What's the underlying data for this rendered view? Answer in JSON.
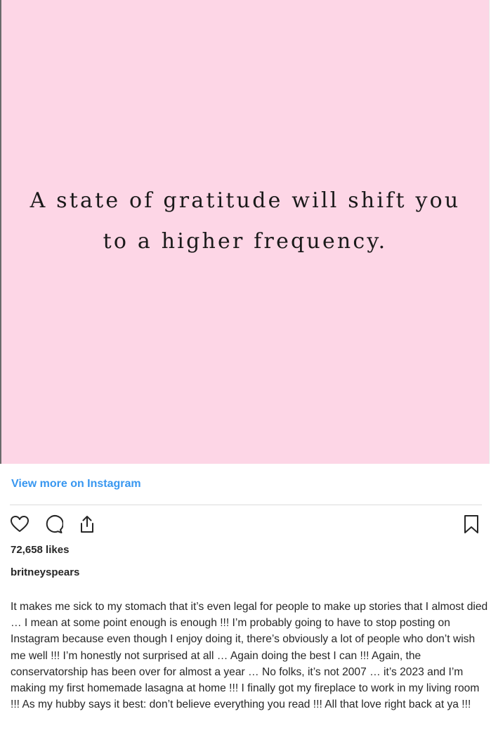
{
  "post": {
    "image": {
      "background_color": "#fdd6e6",
      "quote_line_1": "A state of gratitude will shift you",
      "quote_line_2": "to a higher frequency."
    },
    "view_more_link": "View more on Instagram",
    "actions": {
      "like_icon": "heart-icon",
      "comment_icon": "comment-icon",
      "share_icon": "share-icon",
      "save_icon": "bookmark-icon"
    },
    "likes": "72,658 likes",
    "username": "britneyspears",
    "caption": "It makes me sick to my stomach that it’s even legal for people to make up stories that I almost died … I mean at some point enough is enough !!! I’m probably going to have to stop posting on Instagram because even though I enjoy doing it, there’s obviously a lot of people who don’t wish me well !!! I’m honestly not surprised at all … Again doing the best I can !!! Again, the conservatorship has been over for almost a year … No folks, it’s not 2007 … it’s 2023 and I’m making my first homemade lasagna at home !!! I finally got my fireplace to work in my living room !!! As my hubby says it best: don’t believe everything you read !!! All that love right back at ya !!!"
  },
  "colors": {
    "link": "#3897f0",
    "text": "#262626",
    "divider": "#dbdbdb"
  }
}
